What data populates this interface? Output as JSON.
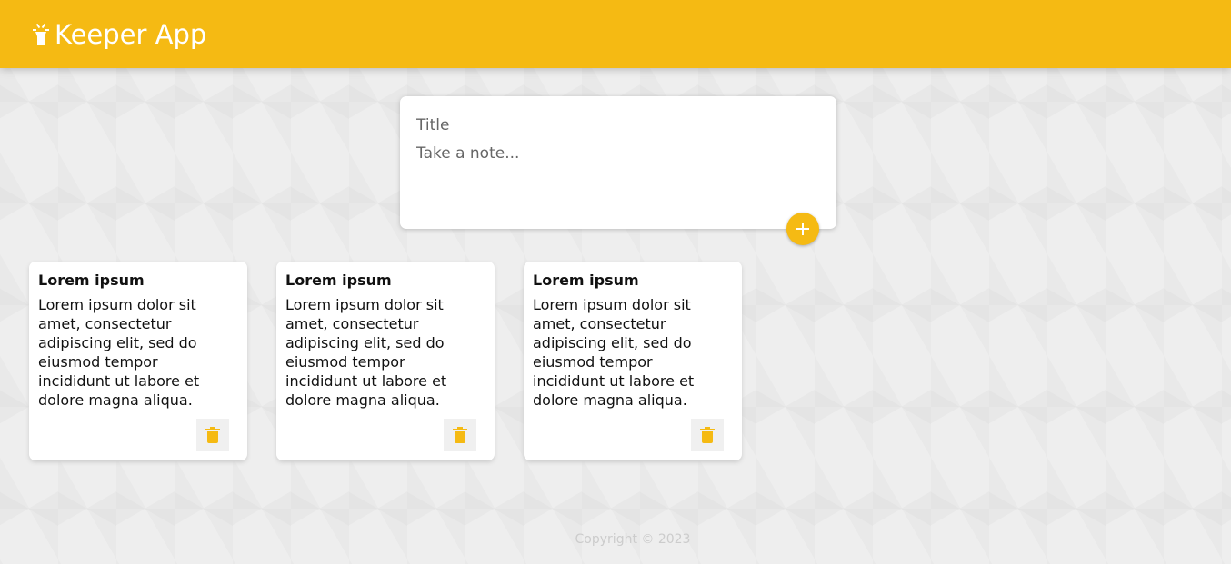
{
  "header": {
    "title": "Keeper App",
    "icon": "highlight-lamp-icon",
    "background_color": "#f5ba13"
  },
  "create_note": {
    "title_placeholder": "Title",
    "content_placeholder": "Take a note...",
    "title_value": "",
    "content_value": "",
    "add_icon": "plus-icon"
  },
  "notes": [
    {
      "title": "Lorem ipsum",
      "content": "Lorem ipsum dolor sit\namet, consectetur\nadipiscing elit, sed do\neiusmod tempor\nincididunt ut labore et\ndolore magna aliqua.",
      "delete_icon": "trash-icon"
    },
    {
      "title": "Lorem ipsum",
      "content": "Lorem ipsum dolor sit\namet, consectetur\nadipiscing elit, sed do\neiusmod tempor\nincididunt ut labore et\ndolore magna aliqua.",
      "delete_icon": "trash-icon"
    },
    {
      "title": "Lorem ipsum",
      "content": "Lorem ipsum dolor sit\namet, consectetur\nadipiscing elit, sed do\neiusmod tempor\nincididunt ut labore et\ndolore magna aliqua.",
      "delete_icon": "trash-icon"
    }
  ],
  "footer": {
    "copyright": "Copyright © 2023"
  },
  "colors": {
    "accent": "#f5ba13",
    "page_background": "#eeeeee",
    "card_background": "#ffffff"
  }
}
